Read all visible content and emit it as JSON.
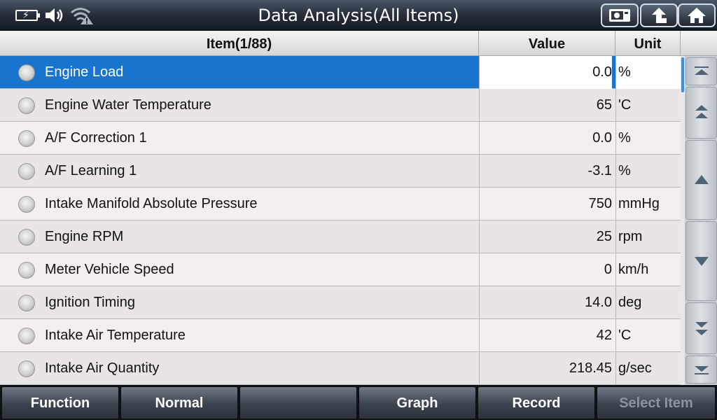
{
  "window": {
    "title": "Data Analysis(All Items)"
  },
  "status": {
    "icons": [
      "battery-charging-icon",
      "speaker-icon",
      "wifi-warning-icon"
    ]
  },
  "toolbar": {
    "buttons": [
      "screenshot-icon",
      "back-icon",
      "home-icon"
    ]
  },
  "table": {
    "headers": {
      "item": "Item(1/88)",
      "value": "Value",
      "unit": "Unit"
    },
    "rows": [
      {
        "name": "Engine Load",
        "value": "0.0",
        "unit": "%"
      },
      {
        "name": "Engine Water Temperature",
        "value": "65",
        "unit": "'C"
      },
      {
        "name": "A/F Correction 1",
        "value": "0.0",
        "unit": "%"
      },
      {
        "name": "A/F Learning 1",
        "value": "-3.1",
        "unit": "%"
      },
      {
        "name": "Intake Manifold Absolute Pressure",
        "value": "750",
        "unit": "mmHg"
      },
      {
        "name": "Engine RPM",
        "value": "25",
        "unit": "rpm"
      },
      {
        "name": "Meter Vehicle Speed",
        "value": "0",
        "unit": "km/h"
      },
      {
        "name": "Ignition Timing",
        "value": "14.0",
        "unit": "deg"
      },
      {
        "name": "Intake Air Temperature",
        "value": "42",
        "unit": "'C"
      },
      {
        "name": "Intake Air Quantity",
        "value": "218.45",
        "unit": "g/sec"
      }
    ],
    "selected_index": 0
  },
  "scroll": {
    "buttons": [
      "scroll-top-icon",
      "page-up-icon",
      "line-up-icon",
      "line-down-icon",
      "page-down-icon",
      "scroll-bottom-icon"
    ]
  },
  "bottom": {
    "function": "Function",
    "normal": "Normal",
    "empty": "",
    "graph": "Graph",
    "record": "Record",
    "select_item": "Select Item"
  },
  "colors": {
    "selected_row": "#1874cd",
    "row_even": "#f5eeee",
    "row_odd": "#e8e4e8"
  }
}
